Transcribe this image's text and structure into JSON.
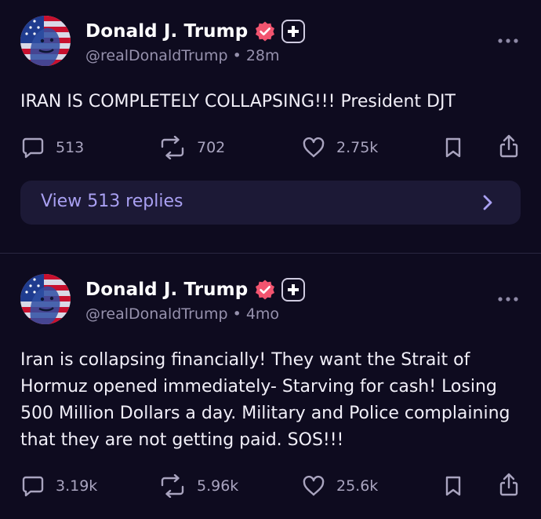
{
  "posts": [
    {
      "author": {
        "display_name": "Donald J. Trump",
        "handle": "@realDonaldTrump",
        "verified_icon": "verified-badge-icon",
        "badge_icon": "plus-badge-icon"
      },
      "age": "28m",
      "separator": "•",
      "text": "IRAN IS COMPLETELY COLLAPSING!!! President DJT",
      "stats": {
        "replies": "513",
        "reposts": "702",
        "likes": "2.75k"
      },
      "view_replies_label": "View 513 replies"
    },
    {
      "author": {
        "display_name": "Donald J. Trump",
        "handle": "@realDonaldTrump",
        "verified_icon": "verified-badge-icon",
        "badge_icon": "plus-badge-icon"
      },
      "age": "4mo",
      "separator": "•",
      "text": "Iran is collapsing financially! They want the Strait of Hormuz opened immediately- Starving for cash! Losing 500 Million Dollars a day. Military and Police complaining that they are not getting paid. SOS!!!",
      "stats": {
        "replies": "3.19k",
        "reposts": "5.96k",
        "likes": "25.6k"
      }
    }
  ],
  "colors": {
    "background": "#0e0b1f",
    "verified_badge": "#f2546f",
    "reply_button_bg": "#1c1936",
    "reply_button_text": "#a9a0f2",
    "muted_text": "#9691ad"
  }
}
